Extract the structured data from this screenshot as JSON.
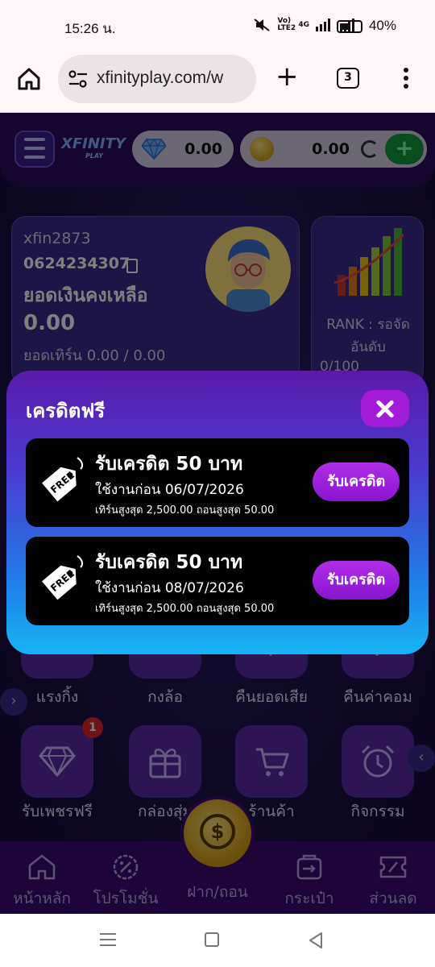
{
  "status_bar": {
    "time": "15:26 น.",
    "network": "Vo) LTE2",
    "signal": "4G",
    "battery": "40%"
  },
  "browser": {
    "url": "xfinityplay.com/w",
    "tab_count": "3"
  },
  "header": {
    "logo_text": "XFINITY",
    "logo_sub": "PLAY",
    "diamond_balance": "0.00",
    "coin_balance": "0.00"
  },
  "profile": {
    "username": "xfin2873",
    "phone": "0624234307",
    "balance_label": "ยอดเงินคงเหลือ",
    "balance": "0.00",
    "turnover": "ยอดเทิร์น 0.00 / 0.00"
  },
  "rank": {
    "line1": "RANK : รอจัด",
    "line2": "อันดับ",
    "progress": "0/100"
  },
  "menu": {
    "row1": [
      {
        "label": "แรงกิ้ง"
      },
      {
        "label": "กงล้อ"
      },
      {
        "label": "คืนยอดเสีย"
      },
      {
        "label": "คืนค่าคอม"
      }
    ],
    "row2": [
      {
        "label": "รับเพชรฟรี",
        "badge": "1"
      },
      {
        "label": "กล่องสุ่ม"
      },
      {
        "label": "ร้านค้า"
      },
      {
        "label": "กิจกรรม"
      }
    ]
  },
  "bottom_nav": {
    "home": "หน้าหลัก",
    "promo": "โปรโมชั่น",
    "deposit": "ฝาก/ถอน",
    "wallet": "กระเป๋า",
    "discount": "ส่วนลด"
  },
  "modal": {
    "title": "เครดิตฟรี",
    "tag_text": "FREE",
    "credits": [
      {
        "title": "รับเครดิต 50 บาท",
        "expiry": "ใช้งานก่อน 06/07/2026",
        "limits": "เทิร์นสูงสุด 2,500.00 ถอนสูงสุด 50.00",
        "button": "รับเครดิต"
      },
      {
        "title": "รับเครดิต 50 บาท",
        "expiry": "ใช้งานก่อน 08/07/2026",
        "limits": "เทิร์นสูงสุด 2,500.00 ถอนสูงสุด 50.00",
        "button": "รับเครดิต"
      }
    ]
  },
  "colors": {
    "modal_top": "#5a1aa8",
    "modal_bottom": "#18b4f4",
    "claim_button": "#a11bd8",
    "card_bg": "#030303",
    "add_button": "#0f9a3a"
  }
}
